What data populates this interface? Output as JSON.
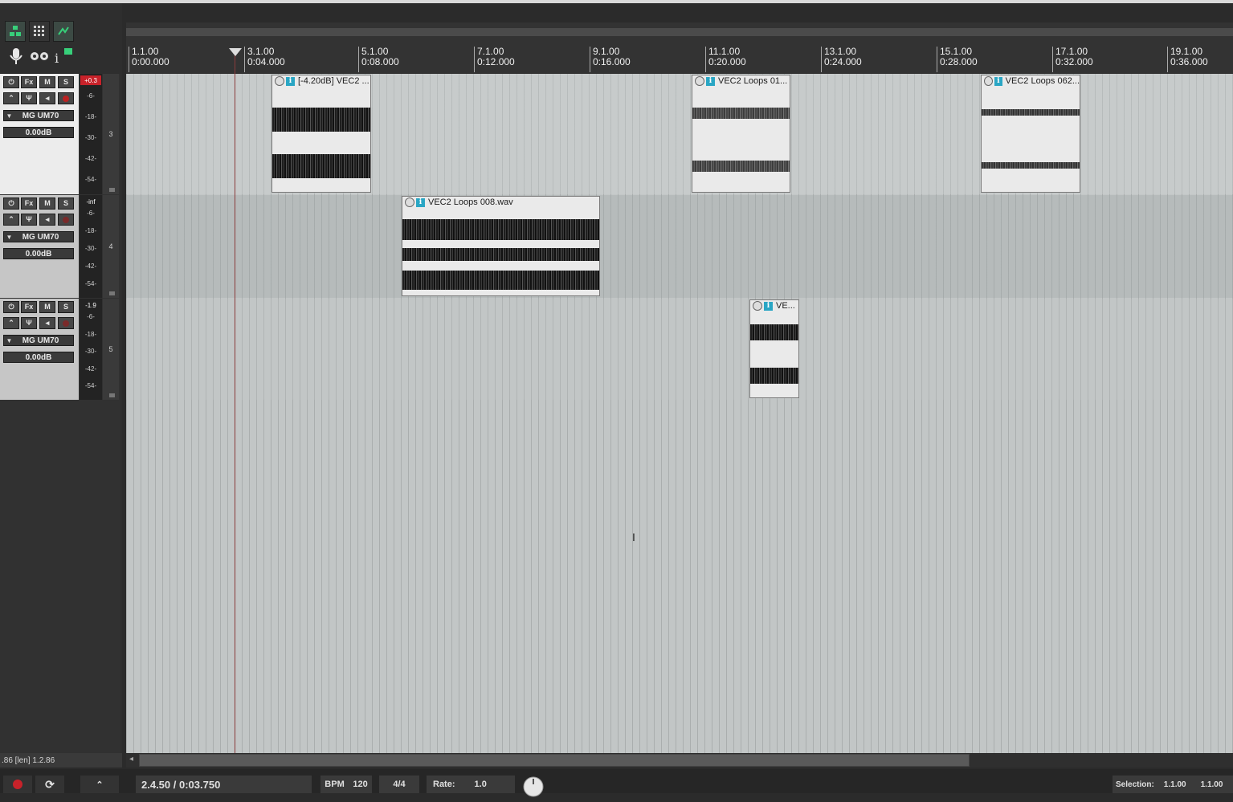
{
  "toolbar": {
    "buttons": [
      "grid-view-icon",
      "snap-grid-icon",
      "ripple-edit-icon",
      "microphone-icon",
      "record-mode-icon",
      "info-icon"
    ]
  },
  "ruler": {
    "marks": [
      {
        "bar": "1.1.00",
        "time": "0:00.000"
      },
      {
        "bar": "3.1.00",
        "time": "0:04.000"
      },
      {
        "bar": "5.1.00",
        "time": "0:08.000"
      },
      {
        "bar": "7.1.00",
        "time": "0:12.000"
      },
      {
        "bar": "9.1.00",
        "time": "0:16.000"
      },
      {
        "bar": "11.1.00",
        "time": "0:20.000"
      },
      {
        "bar": "13.1.00",
        "time": "0:24.000"
      },
      {
        "bar": "15.1.00",
        "time": "0:28.000"
      },
      {
        "bar": "17.1.00",
        "time": "0:32.000"
      },
      {
        "bar": "19.1.00",
        "time": "0:36.000"
      }
    ]
  },
  "tracks": [
    {
      "num": "3",
      "name": "MG UM70",
      "volume": "0.00dB",
      "peak": "+0.3",
      "ticks": [
        "-6-",
        "-18-",
        "-30-",
        "-42-",
        "-54-"
      ],
      "btn_fx": "Fx",
      "btn_m": "M",
      "btn_s": "S"
    },
    {
      "num": "4",
      "name": "MG UM70",
      "volume": "0.00dB",
      "peak": "-inf",
      "ticks": [
        "-6-",
        "-18-",
        "-30-",
        "-42-",
        "-54-"
      ],
      "btn_fx": "Fx",
      "btn_m": "M",
      "btn_s": "S"
    },
    {
      "num": "5",
      "name": "MG UM70",
      "volume": "0.00dB",
      "peak": "-1.9",
      "ticks": [
        "-6-",
        "-18-",
        "-30-",
        "-42-",
        "-54-"
      ],
      "btn_fx": "Fx",
      "btn_m": "M",
      "btn_s": "S"
    }
  ],
  "items": [
    {
      "label": "[-4.20dB] VEC2 ...",
      "track": "3"
    },
    {
      "label": "VEC2 Loops 01...",
      "track": "3"
    },
    {
      "label": "VEC2 Loops 062...",
      "track": "3"
    },
    {
      "label": "VEC2 Loops 008.wav",
      "track": "4"
    },
    {
      "label": "VE...",
      "track": "5"
    }
  ],
  "info_glyph": "i",
  "status": {
    "left_text": ".86 [len] 1.2.86",
    "position": "2.4.50 / 0:03.750",
    "bpm_label": "BPM",
    "bpm_value": "120",
    "time_sig": "4/4",
    "rate_label": "Rate:",
    "rate_value": "1.0",
    "selection_label": "Selection:",
    "selection_start": "1.1.00",
    "selection_end": "1.1.00"
  },
  "colors": {
    "accent": "#2aa6c4",
    "peak_clip": "#c8222a",
    "record": "#c8222a"
  }
}
